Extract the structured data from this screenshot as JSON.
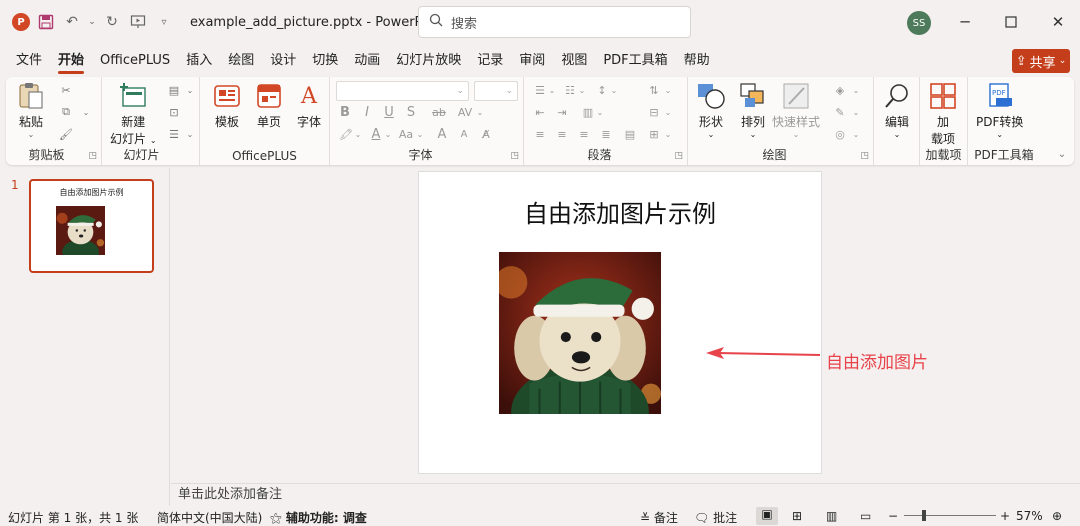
{
  "titlebar": {
    "filename": "example_add_picture.pptx",
    "app_name": "PowerP...",
    "search_placeholder": "搜索",
    "avatar_initials": "SS"
  },
  "menu_tabs": [
    "文件",
    "开始",
    "OfficePLUS",
    "插入",
    "绘图",
    "设计",
    "切换",
    "动画",
    "幻灯片放映",
    "记录",
    "审阅",
    "视图",
    "PDF工具箱",
    "帮助"
  ],
  "active_tab": "开始",
  "share_label": "共享",
  "ribbon": {
    "paste": "粘贴",
    "new_slide_line1": "新建",
    "new_slide_line2": "幻灯片",
    "template": "模板",
    "single_page": "单页",
    "font_btn": "字体",
    "shape": "形状",
    "arrange": "排列",
    "quick_style": "快速样式",
    "edit": "编辑",
    "addin_line1": "加",
    "addin_line2": "载项",
    "pdf_convert": "PDF转换",
    "groups": {
      "clipboard": "剪贴板",
      "slides": "幻灯片",
      "officeplus": "OfficePLUS",
      "font": "字体",
      "paragraph": "段落",
      "drawing": "绘图",
      "addins": "加载项",
      "pdf": "PDF工具箱"
    },
    "font_buttons": {
      "bold": "B",
      "italic": "I",
      "underline": "U",
      "strike": "S",
      "case": "Aa",
      "grow": "A",
      "shrink": "A"
    }
  },
  "thumbnail": {
    "number": "1",
    "title": "自由添加图片示例"
  },
  "slide": {
    "title": "自由添加图片示例",
    "annotation": "自由添加图片"
  },
  "notes_placeholder": "单击此处添加备注",
  "statusbar": {
    "slide_info": "幻灯片 第 1 张，共 1 张",
    "language": "简体中文(中国大陆)",
    "accessibility": "辅助功能: 调查",
    "notes": "备注",
    "comments": "批注",
    "zoom": "57%"
  },
  "colors": {
    "accent": "#c43e1c",
    "annotation": "#e8434a"
  }
}
